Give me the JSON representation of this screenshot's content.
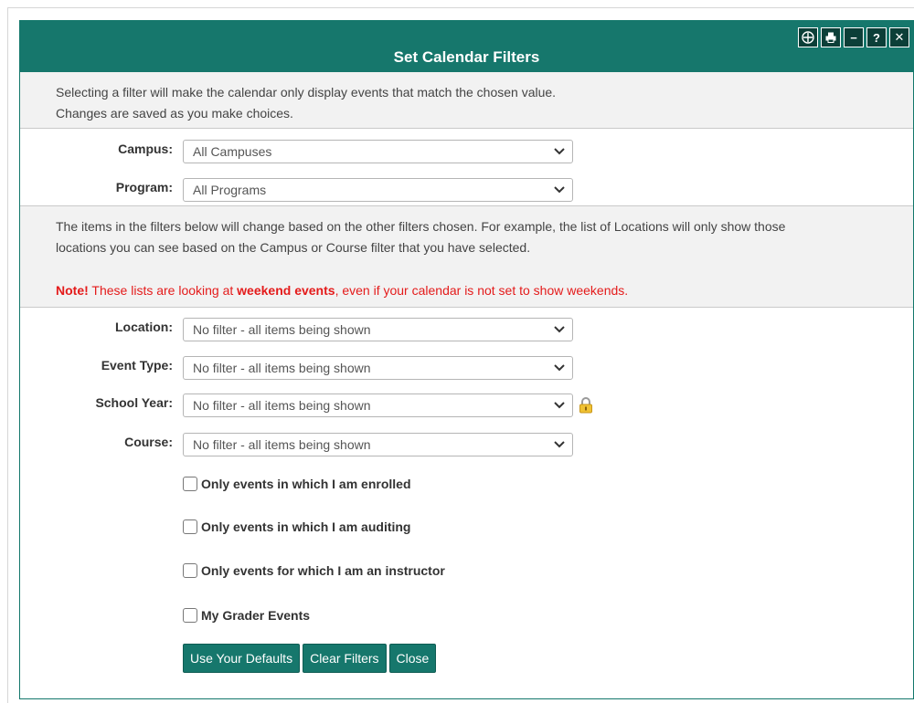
{
  "dialog": {
    "title": "Set Calendar Filters",
    "toolbar_icons": [
      "move-icon",
      "print-icon",
      "minimize-icon",
      "help-icon",
      "close-icon"
    ],
    "toolbar_labels": {
      "minimize": "−",
      "help": "?",
      "close": "✕"
    }
  },
  "info_top": {
    "line1": "Selecting a filter will make the calendar only display events that match the chosen value.",
    "line2": "Changes are saved as you make choices."
  },
  "campus": {
    "label": "Campus:",
    "value": "All Campuses"
  },
  "program": {
    "label": "Program:",
    "value": "All Programs"
  },
  "info_mid": {
    "line1": "The items in the filters below will change based on the other filters chosen. For example, the list of Locations will only show those",
    "line2": "locations you can see based on the Campus or Course filter that you have selected.",
    "note_label": "Note!",
    "note_text1": " These lists are looking at ",
    "note_bold": "weekend events",
    "note_text2": ", even if your calendar is not set to show weekends."
  },
  "filters": {
    "location": {
      "label": "Location:",
      "value": "No filter - all items being shown"
    },
    "event_type": {
      "label": "Event Type:",
      "value": "No filter - all items being shown"
    },
    "school_year": {
      "label": "School Year:",
      "value": "No filter - all items being shown"
    },
    "course": {
      "label": "Course:",
      "value": "No filter - all items being shown"
    }
  },
  "checkboxes": [
    {
      "label": "Only events in which I am enrolled",
      "checked": false
    },
    {
      "label": "Only events in which I am auditing",
      "checked": false
    },
    {
      "label": "Only events for which I am an instructor",
      "checked": false
    },
    {
      "label": "My Grader Events",
      "checked": false
    }
  ],
  "buttons": {
    "defaults": "Use Your Defaults",
    "clear": "Clear Filters",
    "close": "Close"
  },
  "colors": {
    "header": "#16776c",
    "note": "#e41b1b",
    "panel": "#f2f2f2"
  }
}
